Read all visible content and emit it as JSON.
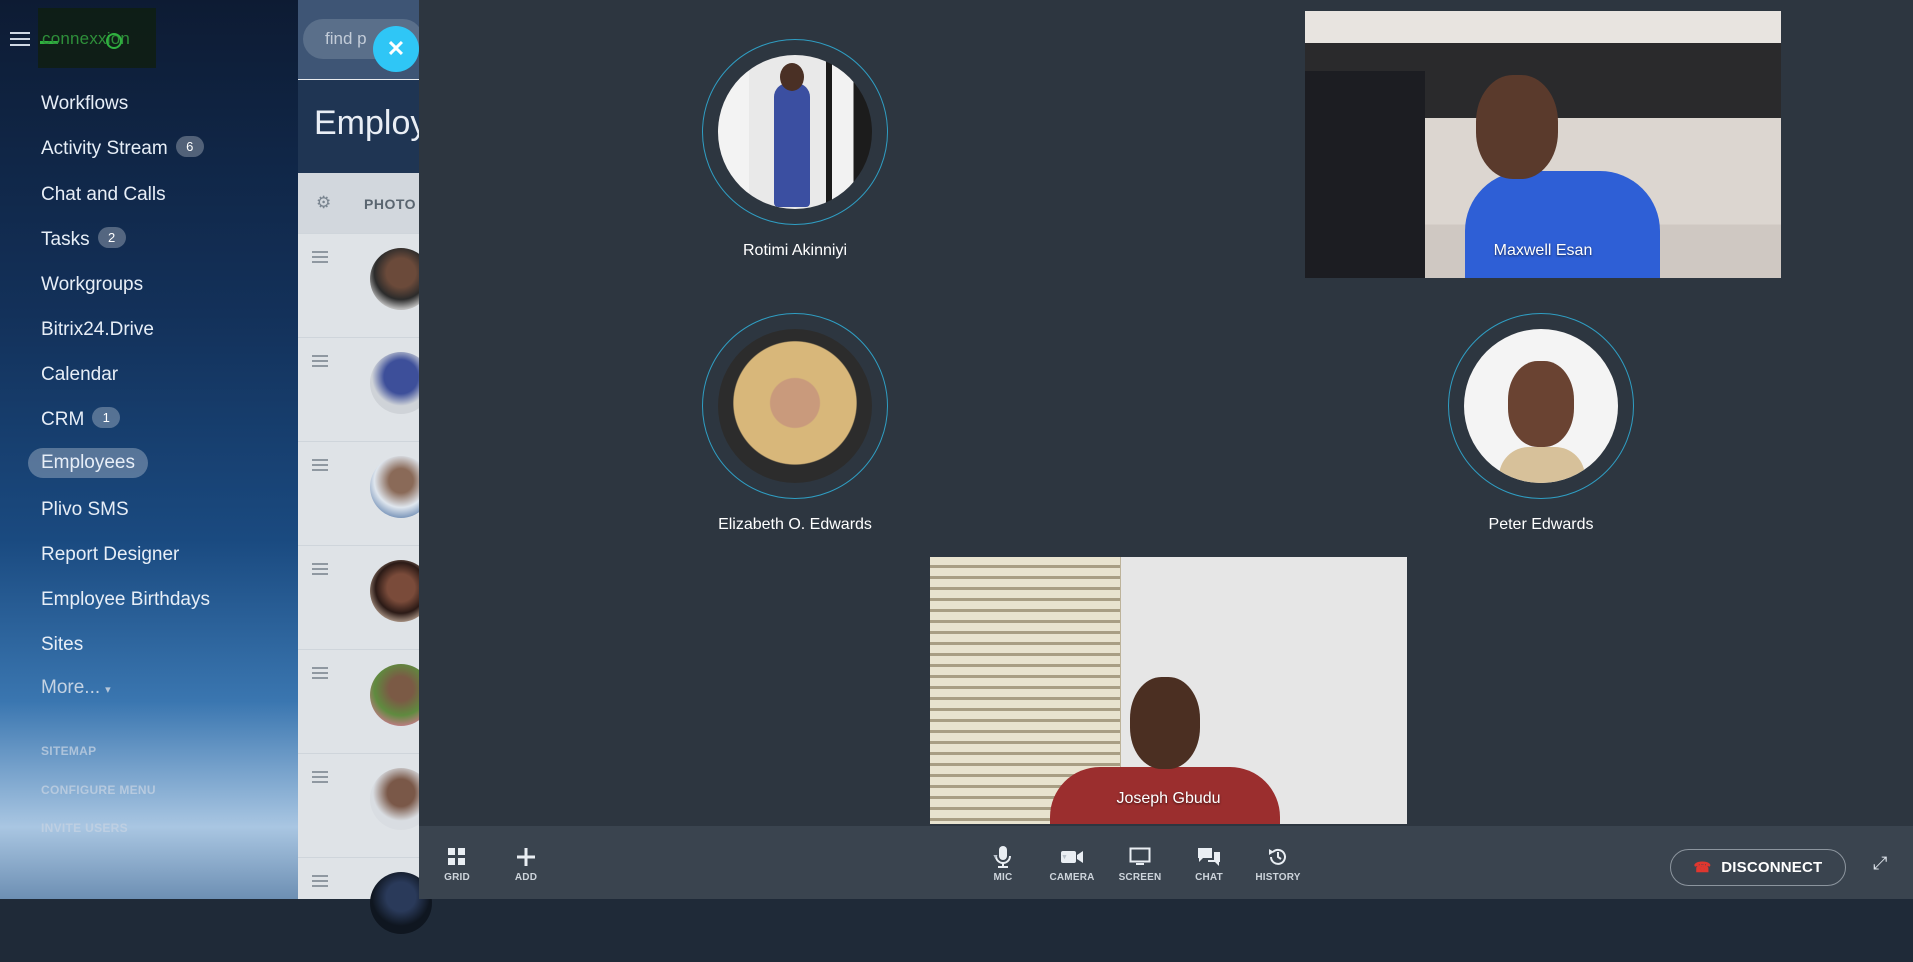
{
  "sidebar": {
    "logo_text": "connexxion",
    "items": [
      {
        "label": "Workflows",
        "count": ""
      },
      {
        "label": "Activity Stream",
        "count": "6"
      },
      {
        "label": "Chat and Calls",
        "count": ""
      },
      {
        "label": "Tasks",
        "count": "2"
      },
      {
        "label": "Workgroups",
        "count": ""
      },
      {
        "label": "Bitrix24.Drive",
        "count": ""
      },
      {
        "label": "Calendar",
        "count": ""
      },
      {
        "label": "CRM",
        "count": "1"
      },
      {
        "label": "Employees",
        "count": "",
        "active": true
      },
      {
        "label": "Plivo SMS",
        "count": ""
      },
      {
        "label": "Report Designer",
        "count": ""
      },
      {
        "label": "Employee Birthdays",
        "count": ""
      },
      {
        "label": "Sites",
        "count": ""
      }
    ],
    "more_label": "More...",
    "links": [
      "SITEMAP",
      "CONFIGURE MENU",
      "INVITE USERS"
    ]
  },
  "page": {
    "search_placeholder": "find p",
    "heading": "Employ",
    "grid_column": "PHOTO"
  },
  "call": {
    "participants": [
      {
        "name": "Rotimi Akinniyi",
        "mode": "avatar"
      },
      {
        "name": "Maxwell Esan",
        "mode": "video"
      },
      {
        "name": "Elizabeth O. Edwards",
        "mode": "avatar"
      },
      {
        "name": "Peter Edwards",
        "mode": "avatar"
      },
      {
        "name": "Joseph Gbudu",
        "mode": "video"
      }
    ],
    "toolbar": {
      "grid": "GRID",
      "add": "ADD",
      "mic": "MIC",
      "camera": "CAMERA",
      "screen": "SCREEN",
      "chat": "CHAT",
      "history": "HISTORY",
      "disconnect": "DISCONNECT"
    }
  },
  "colors": {
    "accent": "#2fc6f6",
    "call_bg": "#2d3640",
    "toolbar_bg": "#3a444f",
    "ring": "#2f9ec3",
    "disconnect_icon": "#e0372f"
  },
  "icons": [
    "menu-icon",
    "close-icon",
    "gear-icon",
    "drag-icon",
    "grid-icon",
    "add-icon",
    "microphone-icon",
    "camera-icon",
    "screen-icon",
    "chat-icon",
    "history-icon",
    "phone-hangup-icon",
    "expand-icon"
  ]
}
